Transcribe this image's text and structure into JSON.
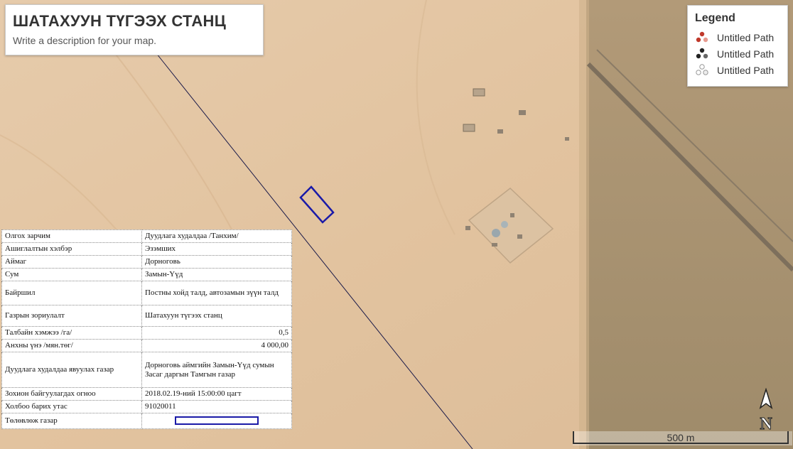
{
  "title": "ШАТАХУУН ТҮГЭЭХ СТАНЦ",
  "description": "Write a description for your map.",
  "legend": {
    "heading": "Legend",
    "items": [
      {
        "label": "Untitled Path",
        "icon": "path-red-icon",
        "color": "#c0392b"
      },
      {
        "label": "Untitled Path",
        "icon": "path-black-icon",
        "color": "#222222"
      },
      {
        "label": "Untitled Path",
        "icon": "path-white-icon",
        "color": "#ffffff"
      }
    ]
  },
  "info_table": {
    "rows": [
      {
        "key": "Олгох зарчим",
        "value": "Дуудлага худалдаа /Танхим/"
      },
      {
        "key": "Ашиглалтын хэлбэр",
        "value": "Эзэмших"
      },
      {
        "key": "Аймаг",
        "value": "Дорноговь"
      },
      {
        "key": "Сум",
        "value": "Замын-Үүд"
      },
      {
        "key": "Байршил",
        "value": "Постны хойд талд, автозамын зүүн талд"
      },
      {
        "key": "Газрын зориулалт",
        "value": "Шатахуун түгээх станц"
      },
      {
        "key": "Талбайн хэмжээ /га/",
        "value": "0,5"
      },
      {
        "key": "Анхны үнэ /мян.төг/",
        "value": "4 000,00"
      },
      {
        "key": "Дуудлага худалдаа явуулах газар",
        "value": "Дорноговь аймгийн Замын-Үүд сумын Засаг даргын Тамгын газар"
      },
      {
        "key": "Зохион байгуулагдах огноо",
        "value": "2018.02.19-ний 15:00:00 цагт"
      },
      {
        "key": "Холбоо барих утас",
        "value": "91020011"
      },
      {
        "key": "Төлөвлөж газар",
        "value": ""
      }
    ]
  },
  "scale_label": "500 m",
  "north_label": "N",
  "colors": {
    "parcel": "#1a1aa8",
    "desert": "#e3c7a4",
    "steppe": "#a5906f"
  }
}
